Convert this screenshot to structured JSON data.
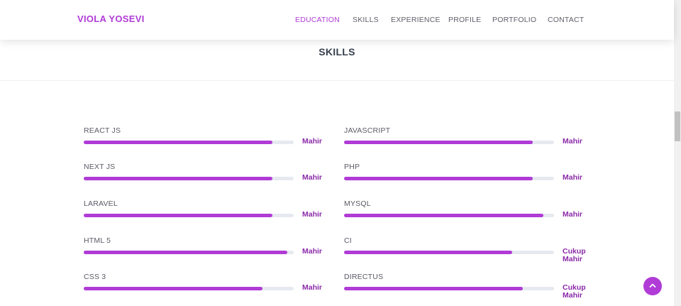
{
  "brand": "VIOLA YOSEVI",
  "nav": [
    "EDUCATION",
    "SKILLS",
    "EXPERIENCE",
    "PROFILE",
    "PORTFOLIO",
    "CONTACT"
  ],
  "active_nav": "EDUCATION",
  "section_title": "SKILLS",
  "skills_left": [
    {
      "name": "REACT JS",
      "level": "Mahir",
      "progress": 0.9
    },
    {
      "name": "NEXT JS",
      "level": "Mahir",
      "progress": 0.9
    },
    {
      "name": "LARAVEL",
      "level": "Mahir",
      "progress": 0.9
    },
    {
      "name": "HTML 5",
      "level": "Mahir",
      "progress": 0.97
    },
    {
      "name": "CSS 3",
      "level": "Mahir",
      "progress": 0.85
    }
  ],
  "skills_right": [
    {
      "name": "JAVASCRIPT",
      "level": "Mahir",
      "progress": 0.9
    },
    {
      "name": "PHP",
      "level": "Mahir",
      "progress": 0.9
    },
    {
      "name": "MYSQL",
      "level": "Mahir",
      "progress": 0.95
    },
    {
      "name": "CI",
      "level": "Cukup Mahir",
      "progress": 0.8
    },
    {
      "name": "DIRECTUS",
      "level": "Cukup Mahir",
      "progress": 0.85
    }
  ],
  "colors": {
    "accent": "#b03bd6",
    "level_text": "#8a2aa8",
    "track": "#e6e9ef"
  },
  "back_to_top_icon": "chevron-up-icon"
}
